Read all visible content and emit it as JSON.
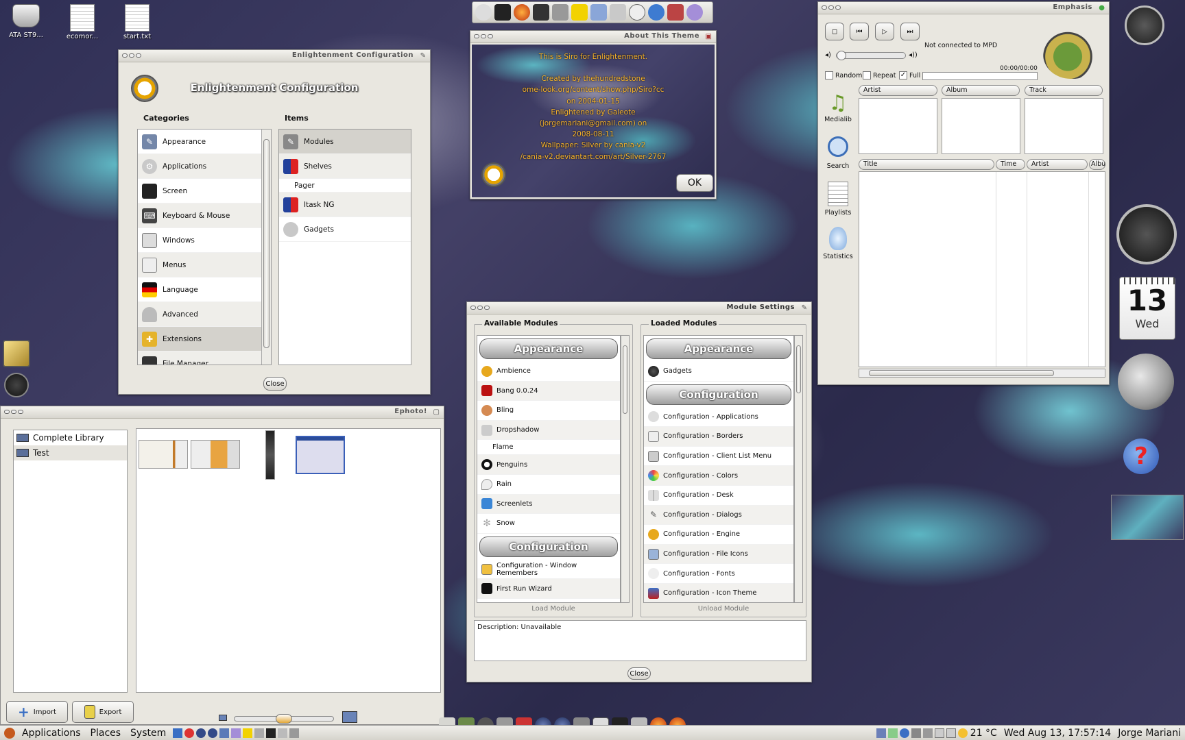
{
  "desktop_icons": [
    {
      "label": "ATA ST9...",
      "icon": "hard-drive-icon"
    },
    {
      "label": "ecomor...",
      "icon": "text-file-icon"
    },
    {
      "label": "start.txt",
      "icon": "text-file-icon"
    }
  ],
  "launcher": {
    "icons": [
      "globe-off-icon",
      "terminal-icon",
      "firefox-icon",
      "media-icon",
      "camera-icon",
      "easytag-icon",
      "documents-icon",
      "package-icon",
      "clock-icon",
      "network-icon",
      "toolbox-icon",
      "ghost-icon"
    ]
  },
  "econfig": {
    "window_title": "Enlightenment Configuration",
    "heading": "Enlightenment Configuration",
    "categories_label": "Categories",
    "items_label": "Items",
    "categories": [
      "Appearance",
      "Applications",
      "Screen",
      "Keyboard & Mouse",
      "Windows",
      "Menus",
      "Language",
      "Advanced",
      "Extensions",
      "File Manager"
    ],
    "items": [
      "Modules",
      "Shelves",
      "Pager",
      "Itask NG",
      "Gadgets"
    ],
    "close_label": "Close"
  },
  "about": {
    "window_title": "About This Theme",
    "lines": [
      "This is  Siro for Enlightenment.",
      "",
      "Created by thehundredstone",
      "ome-look.org/content/show.php/Siro?cc",
      "on 2004-01-15",
      "Enlightened by Galeote",
      "(jorgemariani@gmail.com) on",
      "2008-08-11",
      "Wallpaper: Silver by cania-v2",
      "/cania-v2.deviantart.com/art/Silver-2767"
    ],
    "ok_label": "OK"
  },
  "emphasis": {
    "window_title": "Emphasis",
    "status": "Not connected to MPD",
    "time": "00:00/00:00",
    "checks": [
      {
        "label": "Random",
        "checked": false
      },
      {
        "label": "Repeat",
        "checked": false
      },
      {
        "label": "Full",
        "checked": true
      }
    ],
    "side": [
      "Medialib",
      "Search",
      "Playlists",
      "Statistics"
    ],
    "top_cols": [
      "Artist",
      "Album",
      "Track"
    ],
    "playlist_cols": [
      "Title",
      "Time",
      "Artist",
      "Albu"
    ]
  },
  "calendar": {
    "day": "13",
    "weekday": "Wed"
  },
  "modules": {
    "window_title": "Module Settings",
    "available_label": "Available Modules",
    "loaded_label": "Loaded Modules",
    "avail_header1": "Appearance",
    "avail_list1": [
      "Ambience",
      "Bang 0.0.24",
      "Bling",
      "Dropshadow",
      "Flame",
      "Penguins",
      "Rain",
      "Screenlets",
      "Snow"
    ],
    "avail_header2": "Configuration",
    "avail_list2": [
      "Configuration - Window Remembers",
      "First Run Wizard"
    ],
    "loaded_header1": "Appearance",
    "loaded_list1": [
      "Gadgets"
    ],
    "loaded_header2": "Configuration",
    "loaded_list2": [
      "Configuration - Applications",
      "Configuration - Borders",
      "Configuration - Client List Menu",
      "Configuration - Colors",
      "Configuration - Desk",
      "Configuration - Dialogs",
      "Configuration - Engine",
      "Configuration - File Icons",
      "Configuration - Fonts",
      "Configuration - Icon Theme"
    ],
    "load_label": "Load Module",
    "unload_label": "Unload Module",
    "description": "Description: Unavailable",
    "close_label": "Close"
  },
  "ephoto": {
    "window_title": "Ephoto!",
    "albums": [
      "Complete Library",
      "Test"
    ],
    "import_label": "Import",
    "export_label": "Export"
  },
  "taskbar": {
    "menus": [
      "Applications",
      "Places",
      "System"
    ],
    "temp": "21 °C",
    "clock": "Wed Aug 13, 17:57:14",
    "user": "Jorge Mariani"
  }
}
